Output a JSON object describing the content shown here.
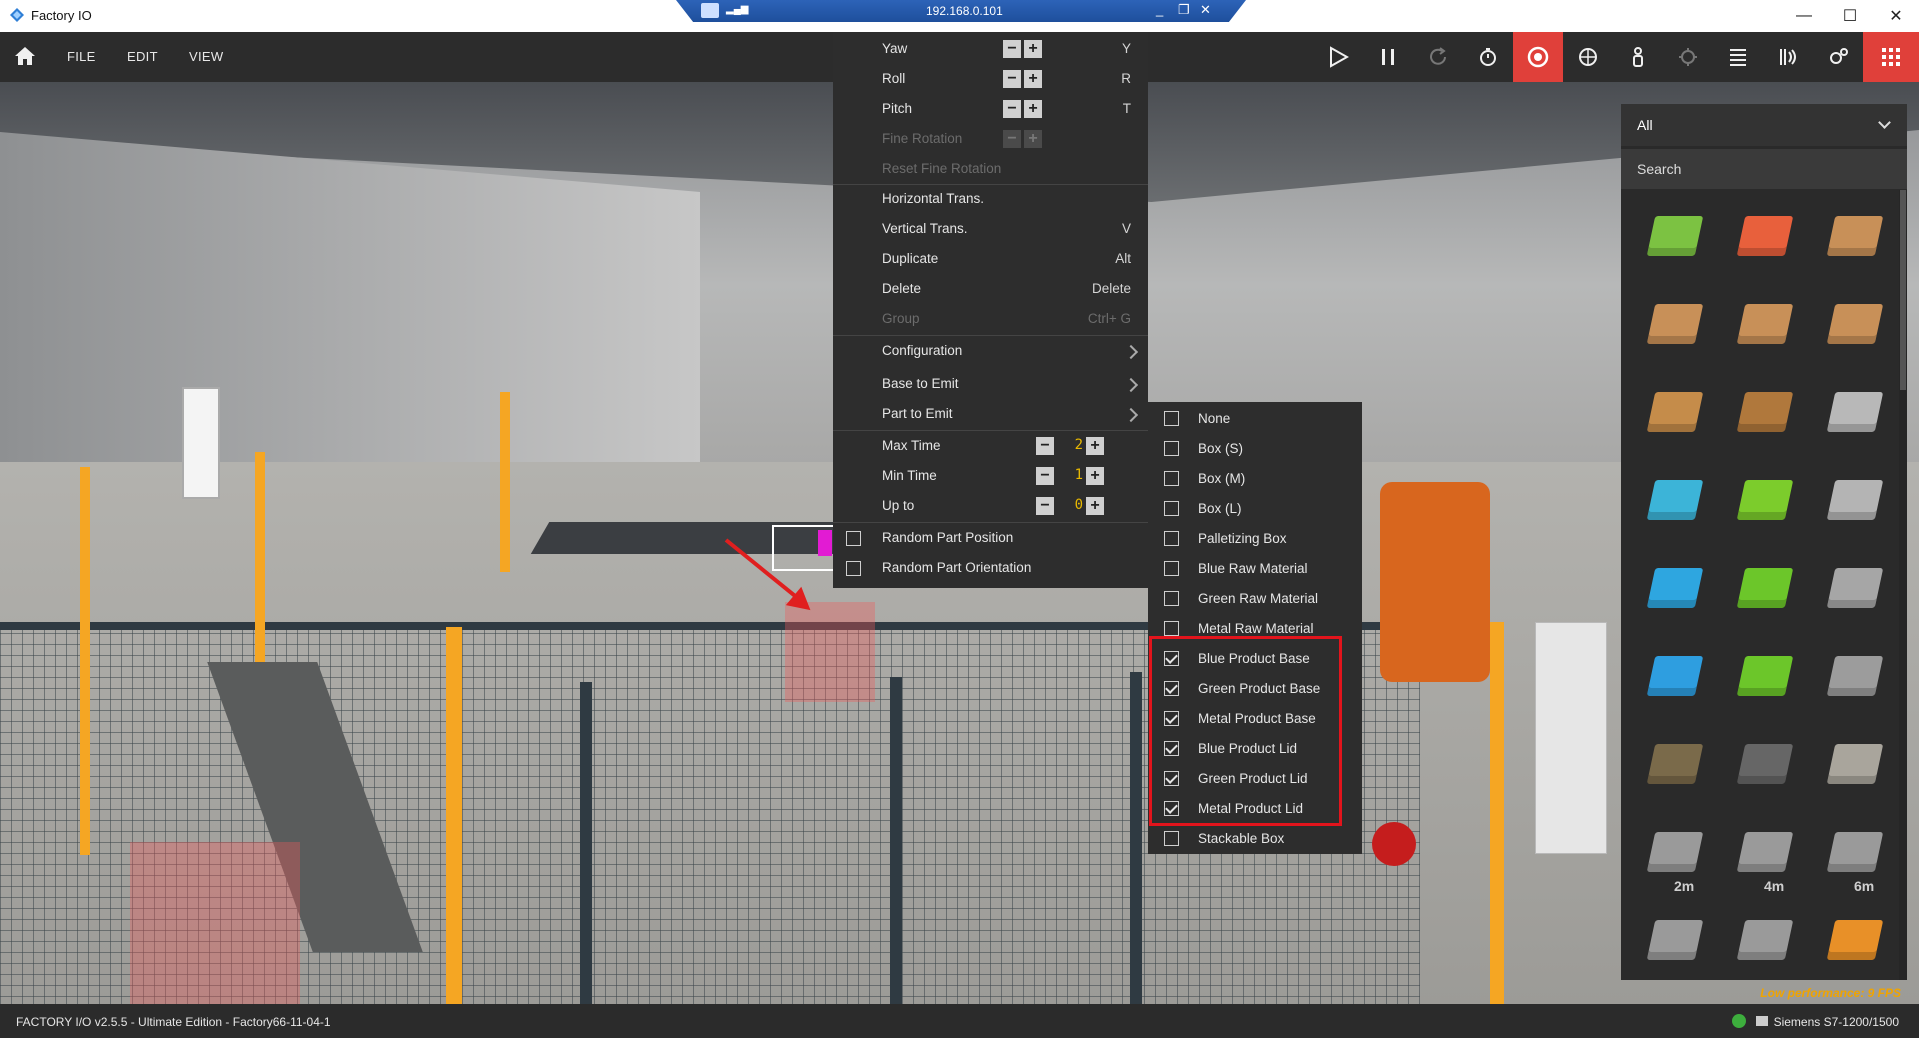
{
  "window": {
    "title": "Factory IO",
    "min": "—",
    "max": "☐",
    "close": "✕"
  },
  "remote": {
    "ip": "192.168.0.101"
  },
  "menu": {
    "file": "FILE",
    "edit": "EDIT",
    "view": "VIEW"
  },
  "toolbar_icons": [
    "play-icon",
    "pause-icon",
    "reset-icon",
    "timer-icon",
    "edit-mode-icon",
    "palette-icon",
    "figure-icon",
    "camera-icon",
    "list-icon",
    "sensor-icon",
    "settings-icon",
    "parts-grid-icon"
  ],
  "context_menu": {
    "yaw": {
      "label": "Yaw",
      "shortcut": "Y"
    },
    "roll": {
      "label": "Roll",
      "shortcut": "R"
    },
    "pitch": {
      "label": "Pitch",
      "shortcut": "T"
    },
    "fine_rotation": {
      "label": "Fine Rotation"
    },
    "reset_fine_rotation": {
      "label": "Reset Fine Rotation"
    },
    "horizontal_trans": {
      "label": "Horizontal Trans."
    },
    "vertical_trans": {
      "label": "Vertical Trans.",
      "shortcut": "V"
    },
    "duplicate": {
      "label": "Duplicate",
      "shortcut": "Alt"
    },
    "delete": {
      "label": "Delete",
      "shortcut": "Delete"
    },
    "group": {
      "label": "Group",
      "shortcut": "Ctrl+ G"
    },
    "configuration": {
      "label": "Configuration"
    },
    "base_to_emit": {
      "label": "Base to Emit"
    },
    "part_to_emit": {
      "label": "Part to Emit"
    },
    "max_time": {
      "label": "Max Time",
      "value": "2"
    },
    "min_time": {
      "label": "Min Time",
      "value": "1"
    },
    "up_to": {
      "label": "Up to",
      "value": "0"
    },
    "random_part_position": {
      "label": "Random Part Position",
      "checked": false
    },
    "random_part_orientation": {
      "label": "Random Part Orientation",
      "checked": false
    }
  },
  "part_submenu": {
    "items": [
      {
        "label": "None",
        "checked": false
      },
      {
        "label": "Box (S)",
        "checked": false
      },
      {
        "label": "Box (M)",
        "checked": false
      },
      {
        "label": "Box (L)",
        "checked": false
      },
      {
        "label": "Palletizing Box",
        "checked": false
      },
      {
        "label": "Blue Raw Material",
        "checked": false
      },
      {
        "label": "Green Raw Material",
        "checked": false
      },
      {
        "label": "Metal Raw Material",
        "checked": false
      },
      {
        "label": "Blue Product Base",
        "checked": true
      },
      {
        "label": "Green Product Base",
        "checked": true
      },
      {
        "label": "Metal Product Base",
        "checked": true
      },
      {
        "label": "Blue Product Lid",
        "checked": true
      },
      {
        "label": "Green Product Lid",
        "checked": true
      },
      {
        "label": "Metal Product Lid",
        "checked": true
      },
      {
        "label": "Stackable Box",
        "checked": false
      }
    ]
  },
  "parts_panel": {
    "filter": "All",
    "search_placeholder": "Search",
    "items": [
      {
        "name": "emitter-icon",
        "color": "#7cc242"
      },
      {
        "name": "remover-icon",
        "color": "#e8603c"
      },
      {
        "name": "small-box-icon",
        "color": "#c89058"
      },
      {
        "name": "medium-box-icon",
        "color": "#c89058"
      },
      {
        "name": "large-box-icon",
        "color": "#c89058"
      },
      {
        "name": "tall-box-icon",
        "color": "#c89058"
      },
      {
        "name": "pallet-icon",
        "color": "#c58c4a"
      },
      {
        "name": "pallet-stack-icon",
        "color": "#b0783c"
      },
      {
        "name": "crate-icon",
        "color": "#b8b8b8"
      },
      {
        "name": "blue-raw-material-icon",
        "color": "#3cb4d8"
      },
      {
        "name": "green-raw-material-icon",
        "color": "#7ccc2c"
      },
      {
        "name": "metal-raw-material-icon",
        "color": "#b4b4b4"
      },
      {
        "name": "blue-product-base-icon",
        "color": "#2ea6e0"
      },
      {
        "name": "green-product-base-icon",
        "color": "#6cc62a"
      },
      {
        "name": "metal-product-base-icon",
        "color": "#a6a6a6"
      },
      {
        "name": "blue-product-lid-icon",
        "color": "#2e9ee0"
      },
      {
        "name": "green-product-lid-icon",
        "color": "#6cc62a"
      },
      {
        "name": "metal-product-lid-icon",
        "color": "#9c9c9c"
      },
      {
        "name": "roller-conveyor-icon",
        "color": "#7a6a4a"
      },
      {
        "name": "belt-conveyor-icon",
        "color": "#666666"
      },
      {
        "name": "plate-icon",
        "color": "#a9a59c"
      },
      {
        "name": "roller-2m-icon",
        "color": "#9a9a9a",
        "label": "2m"
      },
      {
        "name": "roller-4m-icon",
        "color": "#9a9a9a",
        "label": "4m"
      },
      {
        "name": "roller-6m-icon",
        "color": "#9a9a9a",
        "label": "6m"
      },
      {
        "name": "curve-icon",
        "color": "#9a9a9a"
      },
      {
        "name": "curved-roller-icon",
        "color": "#9a9a9a"
      },
      {
        "name": "stopper-icon",
        "color": "#e89028"
      }
    ]
  },
  "viewport": {
    "performance_warning": "Low performance: 9 FPS"
  },
  "status": {
    "left": "FACTORY I/O v2.5.5 - Ultimate Edition - Factory66-11-04-1",
    "right": "Siemens S7-1200/1500"
  },
  "colors": {
    "accent": "#e0403a",
    "highlight": "#e2141c",
    "counter": "#e8b800"
  }
}
